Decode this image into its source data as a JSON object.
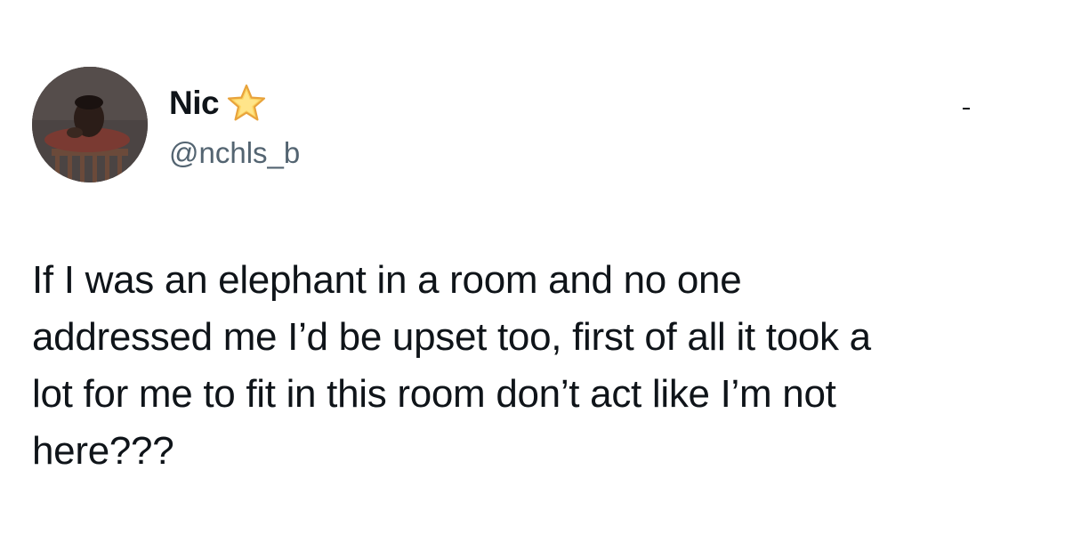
{
  "author": {
    "display_name": "Nic",
    "handle": "@nchls_b",
    "badge_icon": "star-icon",
    "avatar_icon": "profile-photo"
  },
  "tweet": {
    "lines": [
      "If I was an elephant in a room and no one",
      "addressed me I’d be upset too, first of all it took a",
      "lot for me to fit in this room don’t act like I’m not",
      "here???"
    ]
  },
  "colors": {
    "text": "#0f1419",
    "handle": "#536471",
    "star_fill": "#fdd663",
    "star_outline": "#e8a33c"
  }
}
